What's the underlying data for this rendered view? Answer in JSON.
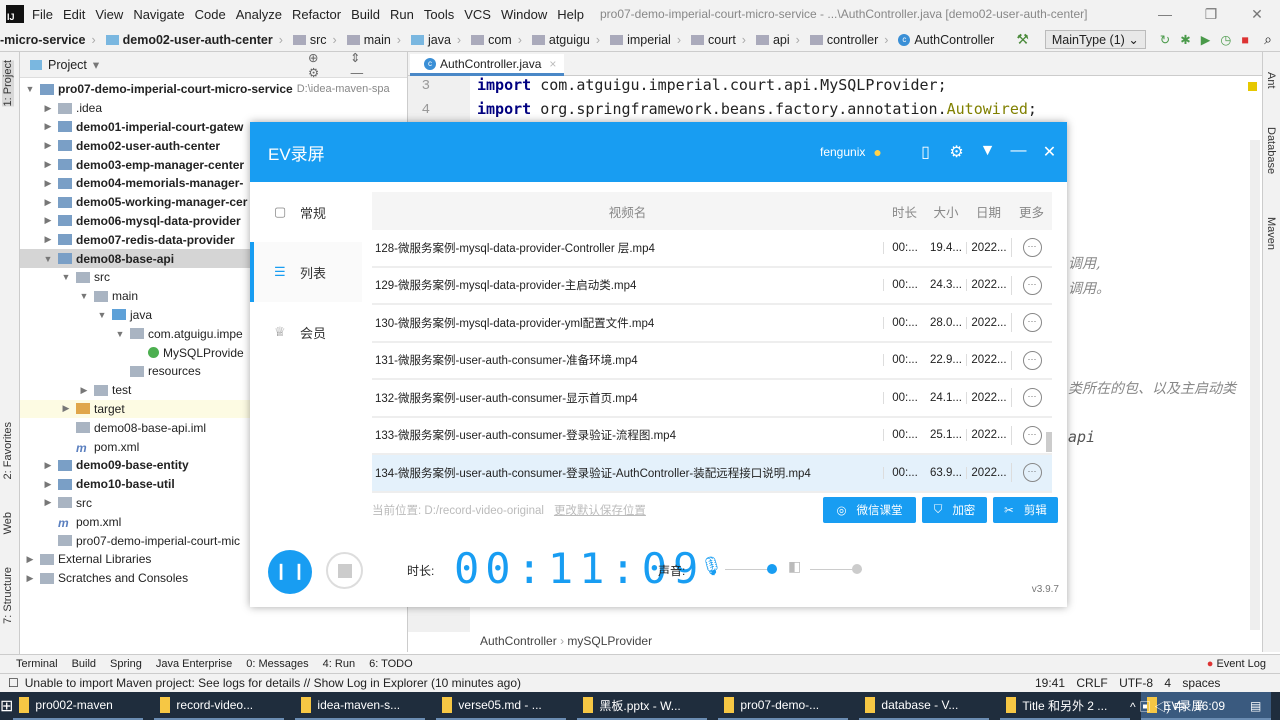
{
  "ide": {
    "menu": [
      "File",
      "Edit",
      "View",
      "Navigate",
      "Code",
      "Analyze",
      "Refactor",
      "Build",
      "Run",
      "Tools",
      "VCS",
      "Window",
      "Help"
    ],
    "window_title": "pro07-demo-imperial-court-micro-service - ...\\AuthController.java [demo02-user-auth-center]",
    "breadcrumbs": [
      "-micro-service",
      "demo02-user-auth-center",
      "src",
      "main",
      "java",
      "com",
      "atguigu",
      "imperial",
      "court",
      "api",
      "controller",
      "AuthController"
    ],
    "run_config": "MainType (1)",
    "left_strip": [
      "1: Project",
      "2: Favorites",
      "Web",
      "7: Structure"
    ],
    "right_strip": [
      "Ant",
      "Database",
      "Maven"
    ],
    "project_header": "Project",
    "tree": [
      {
        "label": "pro07-demo-imperial-court-micro-service",
        "hint": "D:\\idea-maven-spa",
        "bold": true,
        "indent": 0,
        "arrow": "▼",
        "icon": "m"
      },
      {
        "label": ".idea",
        "indent": 1,
        "arrow": "▶",
        "icon": "f"
      },
      {
        "label": "demo01-imperial-court-gatew",
        "bold": true,
        "indent": 1,
        "arrow": "▶",
        "icon": "m"
      },
      {
        "label": "demo02-user-auth-center",
        "bold": true,
        "indent": 1,
        "arrow": "▶",
        "icon": "m"
      },
      {
        "label": "demo03-emp-manager-center",
        "bold": true,
        "indent": 1,
        "arrow": "▶",
        "icon": "m"
      },
      {
        "label": "demo04-memorials-manager-",
        "bold": true,
        "indent": 1,
        "arrow": "▶",
        "icon": "m"
      },
      {
        "label": "demo05-working-manager-cer",
        "bold": true,
        "indent": 1,
        "arrow": "▶",
        "icon": "m"
      },
      {
        "label": "demo06-mysql-data-provider",
        "bold": true,
        "indent": 1,
        "arrow": "▶",
        "icon": "m"
      },
      {
        "label": "demo07-redis-data-provider",
        "bold": true,
        "indent": 1,
        "arrow": "▶",
        "icon": "m"
      },
      {
        "label": "demo08-base-api",
        "bold": true,
        "indent": 1,
        "arrow": "▼",
        "icon": "m",
        "selected": true
      },
      {
        "label": "src",
        "indent": 2,
        "arrow": "▼",
        "icon": "f"
      },
      {
        "label": "main",
        "indent": 3,
        "arrow": "▼",
        "icon": "f"
      },
      {
        "label": "java",
        "indent": 4,
        "arrow": "▼",
        "icon": "s"
      },
      {
        "label": "com.atguigu.impe",
        "indent": 5,
        "arrow": "▼",
        "icon": "f"
      },
      {
        "label": "MySQLProvide",
        "indent": 6,
        "arrow": "",
        "icon": "i"
      },
      {
        "label": "resources",
        "indent": 5,
        "arrow": "",
        "icon": "f"
      },
      {
        "label": "test",
        "indent": 3,
        "arrow": "▶",
        "icon": "f"
      },
      {
        "label": "target",
        "indent": 2,
        "arrow": "▶",
        "icon": "o",
        "highlight": true
      },
      {
        "label": "demo08-base-api.iml",
        "indent": 2,
        "arrow": "",
        "icon": "f"
      },
      {
        "label": "pom.xml",
        "indent": 2,
        "arrow": "",
        "icon": "x"
      },
      {
        "label": "demo09-base-entity",
        "bold": true,
        "indent": 1,
        "arrow": "▶",
        "icon": "m"
      },
      {
        "label": "demo10-base-util",
        "bold": true,
        "indent": 1,
        "arrow": "▶",
        "icon": "m"
      },
      {
        "label": "src",
        "indent": 1,
        "arrow": "▶",
        "icon": "f"
      },
      {
        "label": "pom.xml",
        "indent": 1,
        "arrow": "",
        "icon": "x"
      },
      {
        "label": "pro07-demo-imperial-court-mic",
        "indent": 1,
        "arrow": "",
        "icon": "f"
      },
      {
        "label": "External Libraries",
        "indent": 0,
        "arrow": "▶",
        "icon": "f"
      },
      {
        "label": "Scratches and Consoles",
        "indent": 0,
        "arrow": "▶",
        "icon": "f"
      }
    ],
    "editor_tab": "AuthController.java",
    "code": [
      {
        "line": "3",
        "kw": "import",
        "rest": " com.atguigu.imperial.court.api.MySQLProvider;"
      },
      {
        "line": "4",
        "kw": "import",
        "rest": " org.springframework.beans.factory.annotation.",
        "ann": "Autowired",
        ";": ";"
      }
    ],
    "comment_fragments": [
      "调用,",
      "调用。",
      "类所在的包、以及主启动类",
      "api"
    ],
    "editor_breadcrumb": [
      "AuthController",
      "mySQLProvider"
    ],
    "tool_windows": [
      "Terminal",
      "Build",
      "Spring",
      "Java Enterprise",
      "0: Messages",
      "4: Run",
      "6: TODO"
    ],
    "event_log": "Event Log",
    "status_message": "Unable to import Maven project: See logs for details // Show Log in Explorer (10 minutes ago)",
    "status_right": [
      "19:41",
      "CRLF",
      "UTF-8",
      "4 spaces"
    ]
  },
  "ev": {
    "title": "EV录屏",
    "user": "fengunix",
    "sidebar": [
      "常规",
      "列表",
      "会员"
    ],
    "columns": [
      "视频名",
      "时长",
      "大小",
      "日期",
      "更多"
    ],
    "rows": [
      {
        "name": "128-微服务案例-mysql-data-provider-Controller 层.mp4",
        "dur": "00:...",
        "size": "19.4...",
        "date": "2022..."
      },
      {
        "name": "129-微服务案例-mysql-data-provider-主启动类.mp4",
        "dur": "00:...",
        "size": "24.3...",
        "date": "2022..."
      },
      {
        "name": "130-微服务案例-mysql-data-provider-yml配置文件.mp4",
        "dur": "00:...",
        "size": "28.0...",
        "date": "2022..."
      },
      {
        "name": "131-微服务案例-user-auth-consumer-准备环境.mp4",
        "dur": "00:...",
        "size": "22.9...",
        "date": "2022..."
      },
      {
        "name": "132-微服务案例-user-auth-consumer-显示首页.mp4",
        "dur": "00:...",
        "size": "24.1...",
        "date": "2022..."
      },
      {
        "name": "133-微服务案例-user-auth-consumer-登录验证-流程图.mp4",
        "dur": "00:...",
        "size": "25.1...",
        "date": "2022..."
      },
      {
        "name": "134-微服务案例-user-auth-consumer-登录验证-AuthController-装配远程接口说明.mp4",
        "dur": "00:...",
        "size": "63.9...",
        "date": "2022...",
        "selected": true
      }
    ],
    "path_label": "当前位置:",
    "path": "D:/record-video-original",
    "change_path": "更改默认保存位置",
    "buttons": [
      "微信课堂",
      "加密",
      "剪辑"
    ],
    "duration_label": "时长:",
    "timer": "00:11:09",
    "sound_label": "声音:",
    "mic_level": 0.9,
    "speaker_level": 0.9,
    "version": "v3.9.7"
  },
  "taskbar": {
    "items": [
      "pro002-maven",
      "record-video...",
      "idea-maven-s...",
      "verse05.md - ...",
      "黑板.pptx - W...",
      "pro07-demo-...",
      "database - V...",
      "Title 和另外 2 ...",
      "EV录屏"
    ],
    "tray": "中",
    "clock": "16:09"
  }
}
